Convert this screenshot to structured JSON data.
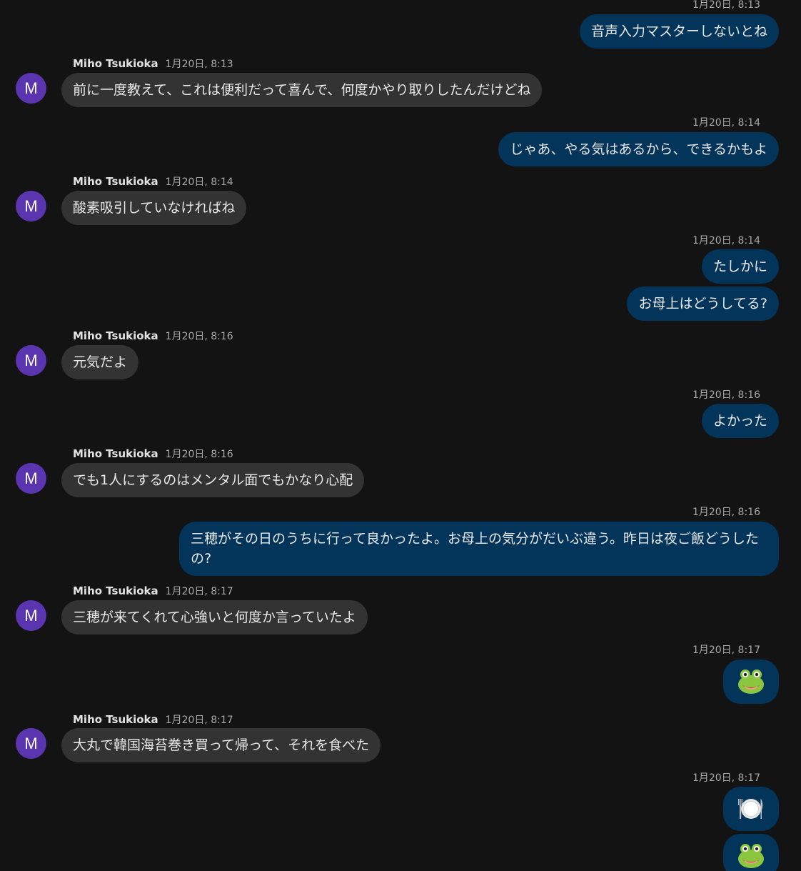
{
  "contact": {
    "name": "Miho Tsukioka",
    "avatar_initial": "M"
  },
  "colors": {
    "background": "#131313",
    "outgoing_bubble": "#03345a",
    "incoming_bubble": "#333333",
    "avatar": "#5b35b0"
  },
  "messages": [
    {
      "dir": "out",
      "time": "1月20日, 8:13",
      "text": "音声入力マスターしないとね"
    },
    {
      "dir": "in",
      "time": "1月20日, 8:13",
      "text": "前に一度教えて、これは便利だって喜んで、何度かやり取りしたんだけどね"
    },
    {
      "dir": "out",
      "time": "1月20日, 8:14",
      "text": "じゃあ、やる気はあるから、できるかもよ"
    },
    {
      "dir": "in",
      "time": "1月20日, 8:14",
      "text": "酸素吸引していなければね"
    },
    {
      "dir": "out",
      "time": "1月20日, 8:14",
      "text": "たしかに"
    },
    {
      "dir": "out",
      "time": "",
      "text": "お母上はどうしてる?"
    },
    {
      "dir": "in",
      "time": "1月20日, 8:16",
      "text": "元気だよ"
    },
    {
      "dir": "out",
      "time": "1月20日, 8:16",
      "text": "よかった"
    },
    {
      "dir": "in",
      "time": "1月20日, 8:16",
      "text": "でも1人にするのはメンタル面でもかなり心配"
    },
    {
      "dir": "out",
      "time": "1月20日, 8:16",
      "text": "三穂がその日のうちに行って良かったよ。お母上の気分がだいぶ違う。昨日は夜ご飯どうしたの?"
    },
    {
      "dir": "in",
      "time": "1月20日, 8:17",
      "text": "三穂が来てくれて心強いと何度か言っていたよ"
    },
    {
      "dir": "out",
      "time": "1月20日, 8:17",
      "emoji": "frog-face-icon"
    },
    {
      "dir": "in",
      "time": "1月20日, 8:17",
      "text": "大丸で韓国海苔巻き買って帰って、それを食べた"
    },
    {
      "dir": "out",
      "time": "1月20日, 8:17",
      "emoji": "fork-knife-plate-icon"
    },
    {
      "dir": "out",
      "time": "",
      "emoji": "frog-face-icon"
    }
  ]
}
